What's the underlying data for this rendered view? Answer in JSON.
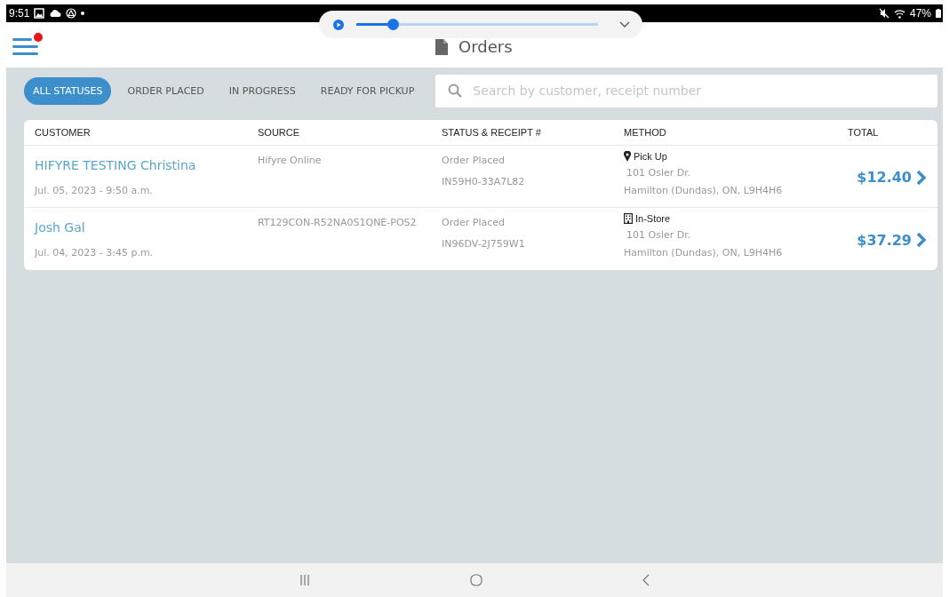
{
  "status_bar": {
    "time": "9:51",
    "battery": "47%"
  },
  "media_player": {
    "level": 0.15
  },
  "header": {
    "title": "Orders",
    "menu_notification": true
  },
  "filters": [
    {
      "label": "ALL STATUSES",
      "selected": true
    },
    {
      "label": "ORDER PLACED",
      "selected": false
    },
    {
      "label": "IN PROGRESS",
      "selected": false
    },
    {
      "label": "READY FOR PICKUP",
      "selected": false
    }
  ],
  "search": {
    "placeholder": "Search by customer, receipt number"
  },
  "table": {
    "columns": [
      "CUSTOMER",
      "SOURCE",
      "STATUS & RECEIPT #",
      "METHOD",
      "TOTAL"
    ],
    "rows": [
      {
        "customer": "HIFYRE TESTING Christina",
        "date": "Jul. 05, 2023 - 9:50 a.m.",
        "source": "Hifyre Online",
        "status": "Order Placed",
        "receipt": "IN59H0-33A7L82",
        "method": {
          "kind": "pickup",
          "label": "Pick Up"
        },
        "address1": "101 Osler Dr.",
        "address2": "Hamilton (Dundas), ON, L9H4H6",
        "total": "$12.40"
      },
      {
        "customer": "Josh Gal",
        "date": "Jul. 04, 2023 - 3:45 p.m.",
        "source": "RT129CON-R52NA0S1QNE-POS2",
        "status": "Order Placed",
        "receipt": "IN96DV-2J759W1",
        "method": {
          "kind": "instore",
          "label": "In-Store"
        },
        "address1": "101 Osler Dr.",
        "address2": "Hamilton (Dundas), ON, L9H4H6",
        "total": "$37.29"
      }
    ]
  }
}
